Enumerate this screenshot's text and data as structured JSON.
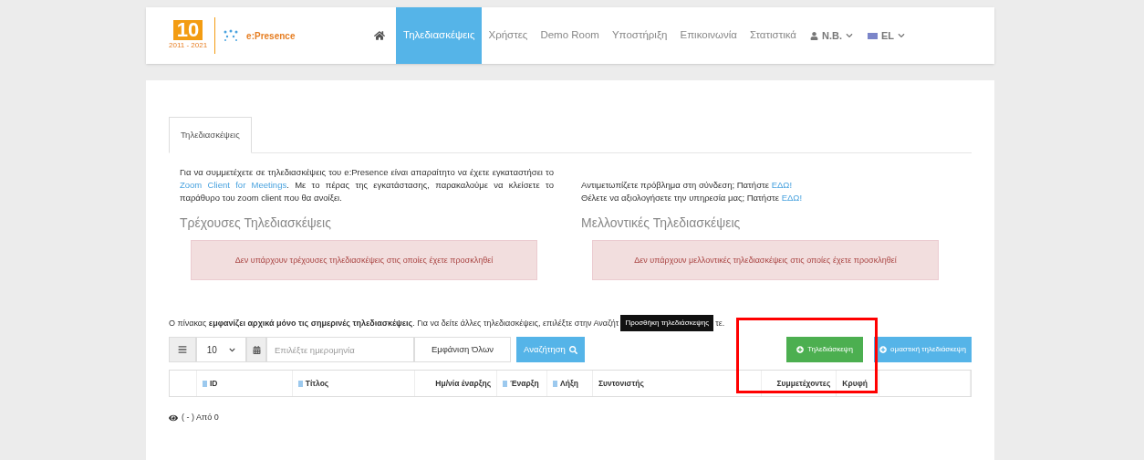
{
  "navbar": {
    "logo": {
      "number": "10",
      "years": "2011 - 2021",
      "brand": "e:Presence"
    },
    "items": [
      {
        "label": "Τηλεδιασκέψεις",
        "selected": true
      },
      {
        "label": "Χρήστες",
        "selected": false
      },
      {
        "label": "Demo Room",
        "selected": false
      },
      {
        "label": "Υποστήριξη",
        "selected": false
      },
      {
        "label": "Επικοινωνία",
        "selected": false
      },
      {
        "label": "Στατιστικά",
        "selected": false
      }
    ],
    "user": "N.B.",
    "language": "EL"
  },
  "tabs": [
    {
      "label": "Τηλεδιασκέψεις",
      "selected": true
    }
  ],
  "intro": {
    "before": "Για να συμμετέχετε σε τηλεδιασκέψεις του e:Presence είναι απαραίτητο να έχετε εγκαταστήσει το",
    "link": "Zoom Client for Meetings",
    "after": ". Με το πέρας της εγκατάστασης, παρακαλούμε να κλείσετε το παράθυρο του zoom client που θα ανοίξει."
  },
  "help": [
    {
      "text": "Αντιμετωπίζετε πρόβλημα στη σύνδεση; Πατήστε",
      "link": "ΕΔΩ!"
    },
    {
      "text": "Θέλετε να αξιολογήσετε την υπηρεσία μας; Πατήστε",
      "link": "ΕΔΩ!"
    }
  ],
  "sections": [
    {
      "title": "Τρέχουσες Τηλεδιασκέψεις",
      "alert": "Δεν υπάρχουν τρέχουσες τηλεδιασκέψεις στις οποίες έχετε προσκληθεί"
    },
    {
      "title": "Μελλοντικές Τηλεδιασκέψεις",
      "alert": "Δεν υπάρχουν μελλοντικές τηλεδιασκέψεις στις οποίες έχετε προσκληθεί"
    }
  ],
  "notice": {
    "start": "Ο πίνακας **εμφανίζει αρχικά μόνο τις σημερινές τηλεδιασκέψεις**. Για να δείτε άλλες τηλεδιασκέψεις, επιλέξτε στην Αναζήτ",
    "end": "τε."
  },
  "tooltip": "Προσθήκη τηλεδιάσκεψης",
  "toolbar": {
    "page_size": "10",
    "date_placeholder": "Επιλέξτε ημερομηνία",
    "show_all": "Εμφάνιση Όλων",
    "search": "Αναζήτηση"
  },
  "actions": [
    {
      "label": "Τηλεδιάσκεψη",
      "kind": "green"
    },
    {
      "label": "ομαστική τηλεδιάσκεψη",
      "kind": "blue"
    }
  ],
  "table": {
    "columns": [
      {
        "sort": false
      },
      {
        "label": "ID",
        "sort": true
      },
      {
        "label": "Τίτλος",
        "sort": true
      },
      {
        "label": "Ημ/νία έναρξης",
        "sort": false
      },
      {
        "label": "Έναρξη",
        "sort": true
      },
      {
        "label": "Λήξη",
        "sort": true
      },
      {
        "label": "Συντονιστής",
        "sort": false
      },
      {
        "label": "Συμμετέχοντες",
        "sort": false
      },
      {
        "label": "Κρυφή",
        "sort": false
      },
      {
        "sort": false
      }
    ]
  },
  "footer": "( - ) Από 0"
}
